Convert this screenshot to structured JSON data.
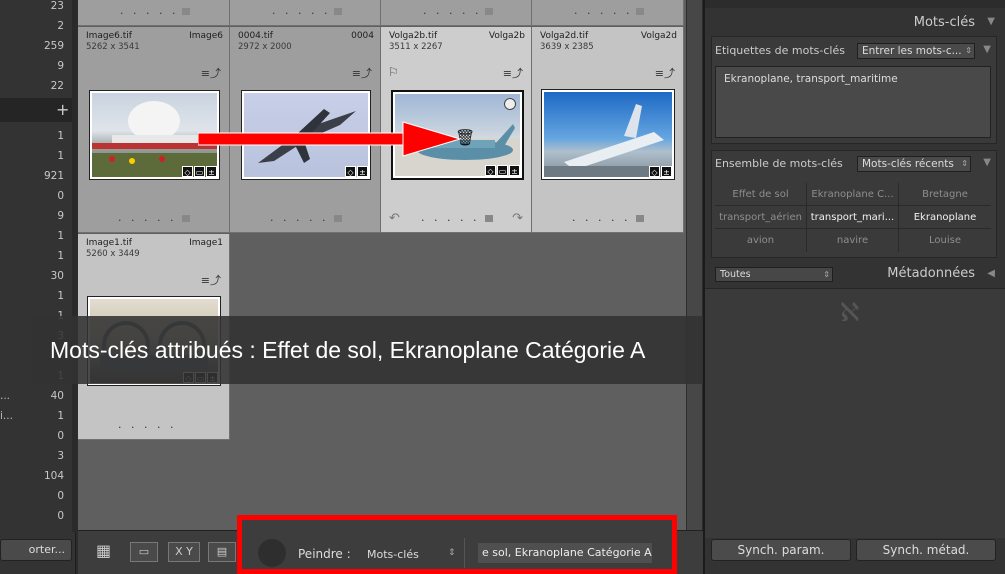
{
  "left_panel": {
    "counts_top": [
      "23",
      "2",
      "259",
      "9",
      "22"
    ],
    "counts_bottom": [
      "1",
      "1",
      "921",
      "0",
      "9",
      "1",
      "1",
      "30",
      "1",
      "1",
      "3",
      "",
      "1",
      "40",
      "1",
      "0",
      "3",
      "104",
      "0",
      "0"
    ],
    "label_a": "...",
    "label_b": "i...",
    "plus": "+",
    "import_button": "orter..."
  },
  "grid": {
    "cells": [
      {
        "filename": "Image6.tif",
        "dims": "5262 x 3541",
        "copy": "Image6"
      },
      {
        "filename": "0004.tif",
        "dims": "2972 x 2000",
        "copy": "0004"
      },
      {
        "filename": "Volga2b.tif",
        "dims": "3511 x 2267",
        "copy": "Volga2b"
      },
      {
        "filename": "Volga2d.tif",
        "dims": "3639 x 2385",
        "copy": "Volga2d"
      },
      {
        "filename": "Image1.tif",
        "dims": "5260 x 3449",
        "copy": "Image1"
      }
    ],
    "dots": ". . . . ."
  },
  "toast": {
    "message": "Mots-clés attribués : Effet de sol, Ekranoplane Catégorie A"
  },
  "toolbar": {
    "paint_label": "Peindre :",
    "paint_mode": "Mots-clés",
    "paint_value": "e sol, Ekranoplane Catégorie A",
    "xy_label": "X Y"
  },
  "right_panel": {
    "title": "Mots-clés",
    "tags_label": "Etiquettes de mots-clés",
    "tags_select": "Entrer les mots-c...",
    "keywords_text": "Ekranoplane, transport_maritime",
    "set_label": "Ensemble de mots-clés",
    "set_select": "Mots-clés récents",
    "keyword_set": [
      {
        "label": "Effet de sol",
        "bold": false
      },
      {
        "label": "Ekranoplane C...",
        "bold": false
      },
      {
        "label": "Bretagne",
        "bold": false
      },
      {
        "label": "transport_aérien",
        "bold": false
      },
      {
        "label": "transport_mari...",
        "bold": true
      },
      {
        "label": "Ekranoplane",
        "bold": true
      },
      {
        "label": "avion",
        "bold": false
      },
      {
        "label": "navire",
        "bold": false
      },
      {
        "label": "Louise",
        "bold": false
      }
    ],
    "meta_select": "Toutes",
    "meta_title": "Métadonnées",
    "ornament": "ℵ",
    "sync_params": "Synch. param.",
    "sync_meta": "Synch. métad."
  },
  "colors": {
    "highlight": "#ff0000",
    "panel": "#333333",
    "grid_bg": "#5f5f5f"
  }
}
